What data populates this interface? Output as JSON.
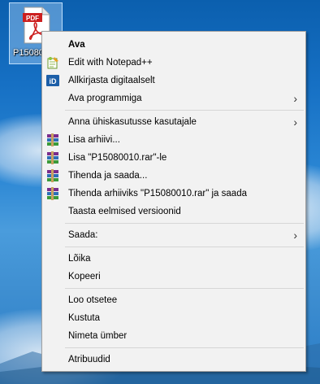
{
  "desktop": {
    "file_label": "P15080010"
  },
  "context_menu": {
    "items": [
      {
        "label": "Ava"
      },
      {
        "label": "Edit with Notepad++"
      },
      {
        "label": "Allkirjasta digitaalselt"
      },
      {
        "label": "Ava programmiga"
      },
      {
        "label": "Anna ühiskasutusse kasutajale"
      },
      {
        "label": "Lisa arhiivi..."
      },
      {
        "label": "Lisa \"P15080010.rar\"-le"
      },
      {
        "label": "Tihenda ja saada..."
      },
      {
        "label": "Tihenda arhiiviks \"P15080010.rar\" ja saada"
      },
      {
        "label": "Taasta eelmised versioonid"
      },
      {
        "label": "Saada:"
      },
      {
        "label": "Lõika"
      },
      {
        "label": "Kopeeri"
      },
      {
        "label": "Loo otsetee"
      },
      {
        "label": "Kustuta"
      },
      {
        "label": "Nimeta ümber"
      },
      {
        "label": "Atribuudid"
      }
    ],
    "submenu_arrow": "›"
  },
  "icons": {
    "pdf": "pdf-file-icon",
    "notepad": "notepad-plus-plus-icon",
    "signature": "id-card-icon",
    "winrar": "winrar-books-icon"
  },
  "colors": {
    "menu_background": "#f2f2f2",
    "separator": "#d6d6d6",
    "pdf_red": "#cc1f1f"
  }
}
